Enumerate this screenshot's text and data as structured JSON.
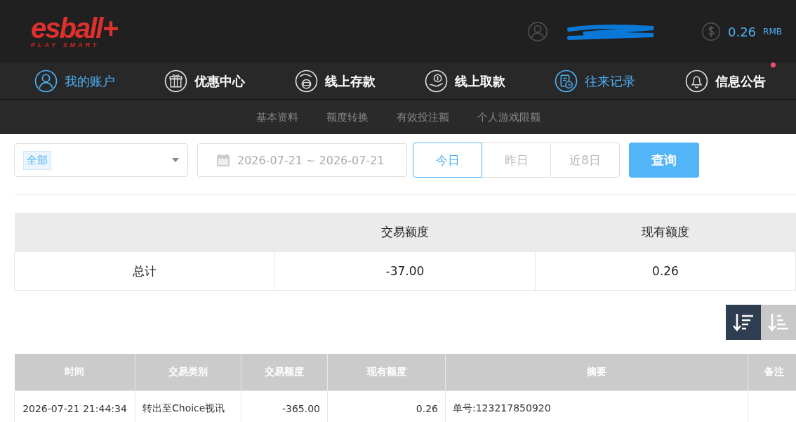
{
  "logo": {
    "wordmark": "esball+",
    "tagline": "PLAY SMART"
  },
  "account": {
    "balance": "0.26",
    "currency": "RMB"
  },
  "nav": [
    {
      "label": "我的账户",
      "selected": true,
      "badge": false
    },
    {
      "label": "优惠中心",
      "selected": false,
      "badge": false
    },
    {
      "label": "线上存款",
      "selected": false,
      "badge": false
    },
    {
      "label": "线上取款",
      "selected": false,
      "badge": false
    },
    {
      "label": "往来记录",
      "selected": true,
      "badge": false
    },
    {
      "label": "信息公告",
      "selected": false,
      "badge": true
    }
  ],
  "subnav": [
    "基本资料",
    "额度转换",
    "有效投注额",
    "个人游戏限额"
  ],
  "filters": {
    "type_select": {
      "value": "全部"
    },
    "date_range": {
      "value": "2026-07-21 ~ 2026-07-21"
    },
    "quick_ranges": [
      {
        "label": "今日",
        "selected": true
      },
      {
        "label": "昨日",
        "selected": false
      },
      {
        "label": "近8日",
        "selected": false
      }
    ],
    "search_button": "查询"
  },
  "summary": {
    "columns": [
      "",
      "交易额度",
      "现有额度"
    ],
    "rows": [
      [
        "总计",
        "-37.00",
        "0.26"
      ]
    ]
  },
  "sort_buttons": [
    {
      "kind": "descending",
      "selected": true
    },
    {
      "kind": "ascending",
      "selected": false
    }
  ],
  "transactions": {
    "columns": [
      "时间",
      "交易类别",
      "交易额度",
      "现有额度",
      "摘要",
      "备注"
    ],
    "rows": [
      [
        "2026-07-21 21:44:34",
        "转出至Choice视讯",
        "-365.00",
        "0.26",
        "单号:123217850920"
      ]
    ]
  }
}
